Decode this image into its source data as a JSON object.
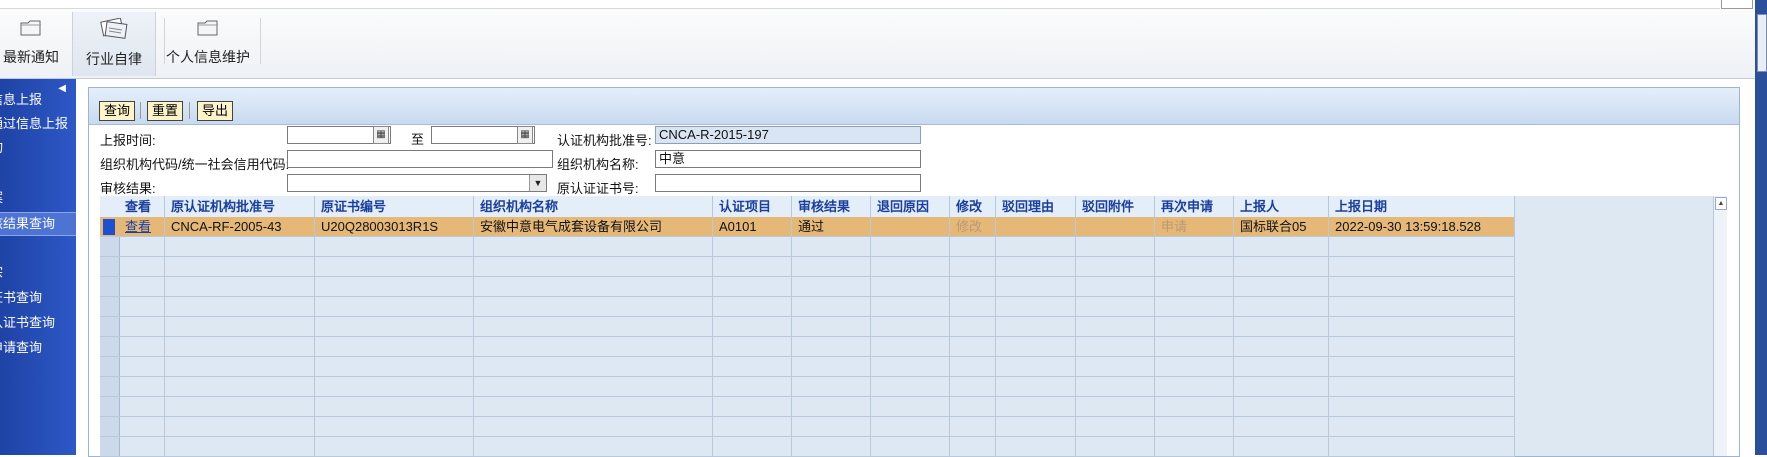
{
  "toolbar": {
    "items": [
      {
        "label": "最新通知",
        "icon": "folder-icon"
      },
      {
        "label": "行业自律",
        "icon": "documents-icon",
        "active": true
      },
      {
        "label": "个人信息维护",
        "icon": "folder-icon"
      }
    ]
  },
  "sidebar": {
    "collapse_icon": "triangle-left-icon",
    "items": [
      {
        "label": "信息上报"
      },
      {
        "label": "通过信息上报"
      },
      {
        "label": "询"
      },
      {
        "label": "案"
      },
      {
        "label": "核结果查询",
        "selected": true
      },
      {
        "label": "宗"
      },
      {
        "label": "证书查询"
      },
      {
        "label": "认证书查询"
      },
      {
        "label": "申请查询"
      }
    ]
  },
  "query_bar": {
    "search_label": "查询",
    "reset_label": "重置",
    "export_label": "导出"
  },
  "form": {
    "report_time_label": "上报时间:",
    "to_label": "至",
    "report_time_from": "",
    "report_time_to": "",
    "approval_no_label": "认证机构批准号:",
    "approval_no_value": "CNCA-R-2015-197",
    "org_code_label": "组织机构代码/统一社会信用代码:",
    "org_code_value": "",
    "org_name_label": "组织机构名称:",
    "org_name_value": "中意",
    "review_result_label": "审核结果:",
    "review_result_value": "",
    "orig_cert_no_label": "原认证证书号:",
    "orig_cert_no_value": ""
  },
  "grid": {
    "columns": [
      "查看",
      "原认证机构批准号",
      "原证书编号",
      "组织机构名称",
      "认证项目",
      "审核结果",
      "退回原因",
      "修改",
      "驳回理由",
      "驳回附件",
      "再次申请",
      "上报人",
      "上报日期"
    ],
    "rows": [
      {
        "view": "查看",
        "orig_approval_no": "CNCA-RF-2005-43",
        "orig_cert_no": "U20Q28003013R1S",
        "org_name": "安徽中意电气成套设备有限公司",
        "cert_item": "A0101",
        "review_result": "通过",
        "return_reason": "",
        "modify": "修改",
        "reject_reason": "",
        "reject_attachment": "",
        "reapply": "申请",
        "reporter": "国标联合05",
        "report_date": "2022-09-30 13:59:18.528"
      }
    ]
  },
  "colors": {
    "sidebar": "#2d58c6",
    "selected_row": "#e6b877",
    "header_text": "#1a3f9e",
    "readonly_input": "#d9e5f2",
    "button_bg": "#fff4c9"
  }
}
